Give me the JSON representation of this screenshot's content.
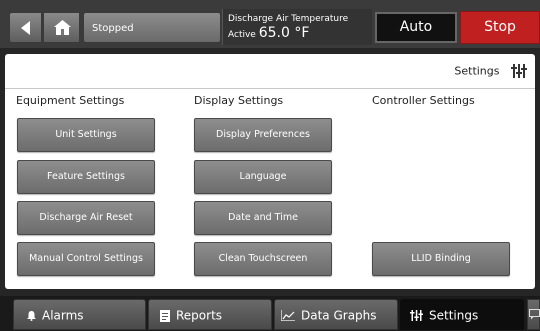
{
  "topbar": {
    "status_text": "Stopped",
    "reading_label": "Discharge Air Temperature",
    "reading_prefix": "Active",
    "reading_value": "65.0 °F",
    "auto_label": "Auto",
    "stop_label": "Stop",
    "colors": {
      "stop": "#c0201f",
      "auto_bg": "#111111"
    }
  },
  "panel": {
    "header_label": "Settings",
    "columns": [
      {
        "title": "Equipment Settings",
        "buttons": [
          "Unit Settings",
          "Feature Settings",
          "Discharge Air Reset",
          "Manual Control Settings"
        ]
      },
      {
        "title": "Display Settings",
        "buttons": [
          "Display Preferences",
          "Language",
          "Date and Time",
          "Clean Touchscreen"
        ]
      },
      {
        "title": "Controller Settings",
        "buttons": [
          "LLID Binding"
        ]
      }
    ]
  },
  "nav": {
    "items": [
      {
        "label": "Alarms",
        "icon": "bell-icon"
      },
      {
        "label": "Reports",
        "icon": "document-icon"
      },
      {
        "label": "Data Graphs",
        "icon": "line-graph-icon"
      },
      {
        "label": "Settings",
        "icon": "sliders-icon",
        "active": true
      }
    ]
  }
}
